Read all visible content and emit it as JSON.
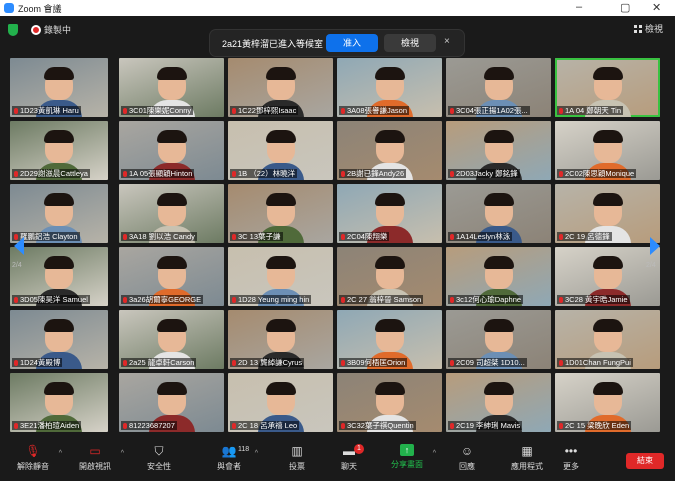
{
  "window": {
    "title": "Zoom 會議"
  },
  "top": {
    "recording_label": "錄製中",
    "view_label": "檢視"
  },
  "notice": {
    "message": "2a21黃梓溜已進入等候室",
    "admit_label": "准入",
    "see_label": "檢視",
    "close": "×"
  },
  "pagination": {
    "left": "2/4",
    "right": "2/4"
  },
  "participants": [
    "1D23黃凱琳 Haru",
    "3C01陳樂妮Conny",
    "1C22鄧梓熙Isaac",
    "3A08張譽謙Jason",
    "3C04張正揚1A02張...",
    "1A 04 鄭朝天 Tin",
    "2D29謝滋晨Cattleya",
    "1A 05張顯穎Hinton",
    "1B （22）林曉洋",
    "2B謝已鋒Andy26",
    "2D03Jacky 鄭銘鋒",
    "2C02陳思穎Monique",
    "羅鵬鋁浩 Clayton",
    "3A18 劉以浩 Candy",
    "3C 13葉子謙",
    "2C04陳翔樂",
    "1A14Leslyn林泳",
    "2C 19 呂德鋒",
    "3D05陳昊洋 Samuel",
    "3a26胡爾寧GEORGE",
    "1D28 Yeung ming hin",
    "2C 27 翁梓晉 Samson",
    "3c12何心瑜Daphne",
    "3C28 黃宇晧Jamie",
    "1D24黃殿博",
    "2a25 龍卓軒Carson",
    "2D 13 龔綽謙Cyrus",
    "3B09何梧匡Orion",
    "2C09 司超桀 1D10...",
    "1D01Chan FungPui",
    "3E21潘柏瑄Aiden",
    "81223687207",
    "2C 18 呂承禧 Leo",
    "3C32葉子祺Quentin",
    "2C19 李紳琍 Mavis",
    "2C 15 梁晚欣 Eden"
  ],
  "toolbar": {
    "unmute": "解除靜音",
    "video": "開啟視訊",
    "security": "安全性",
    "participants": "與會者",
    "participant_count": "118",
    "polls": "投票",
    "chat": "聊天",
    "chat_badge": "1",
    "share": "分享畫面",
    "reactions": "回應",
    "apps": "應用程式",
    "more": "更多",
    "end": "結束"
  },
  "colors": {
    "accent": "#2d8cff",
    "share": "#22b14c",
    "end": "#e02828"
  }
}
